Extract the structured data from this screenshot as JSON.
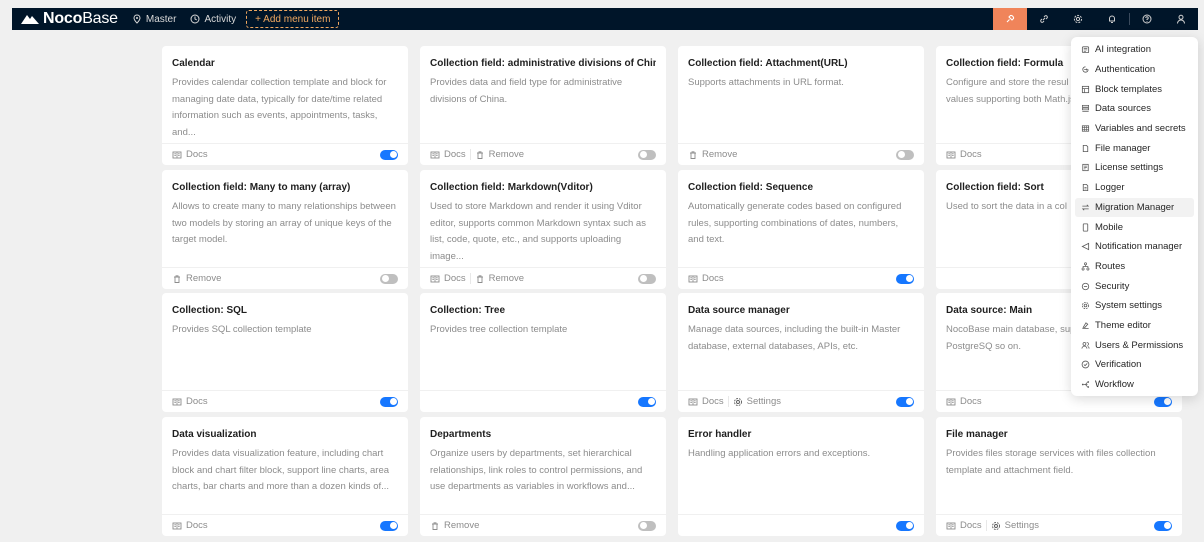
{
  "header": {
    "logo_bold": "Noco",
    "logo_light": "Base",
    "nav": [
      {
        "label": "Master",
        "icon": "location-pin-icon"
      },
      {
        "label": "Activity",
        "icon": "clock-icon"
      }
    ],
    "add_menu_label": "+ Add menu item",
    "right_icons": [
      "plugin-icon",
      "link-icon",
      "gear-icon",
      "bell-icon",
      "help-icon",
      "user-icon"
    ]
  },
  "footer_labels": {
    "docs": "Docs",
    "remove": "Remove",
    "settings": "Settings"
  },
  "cards": [
    {
      "title": "Calendar",
      "desc": "Provides calendar collection template and block for managing date data, typically for date/time related information such as events, appointments, tasks, and...",
      "docs": true,
      "remove": false,
      "settings": false,
      "enabled": true
    },
    {
      "title": "Collection field: administrative divisions of China",
      "desc": "Provides data and field type for administrative divisions of China.",
      "docs": true,
      "remove": true,
      "settings": false,
      "enabled": false
    },
    {
      "title": "Collection field: Attachment(URL)",
      "desc": "Supports attachments in URL format.",
      "docs": false,
      "remove": true,
      "settings": false,
      "enabled": false
    },
    {
      "title": "Collection field: Formula",
      "desc": "Configure and store the resul between multiple field values supporting both Math.js and",
      "docs": true,
      "remove": false,
      "settings": false,
      "enabled": null
    },
    {
      "title": "Collection field: Many to many (array)",
      "desc": "Allows to create many to many relationships between two models by storing an array of unique keys of the target model.",
      "docs": false,
      "remove": true,
      "settings": false,
      "enabled": false
    },
    {
      "title": "Collection field: Markdown(Vditor)",
      "desc": "Used to store Markdown and render it using Vditor editor, supports common Markdown syntax such as list, code, quote, etc., and supports uploading image...",
      "docs": true,
      "remove": true,
      "settings": false,
      "enabled": false
    },
    {
      "title": "Collection field: Sequence",
      "desc": "Automatically generate codes based on configured rules, supporting combinations of dates, numbers, and text.",
      "docs": true,
      "remove": false,
      "settings": false,
      "enabled": true
    },
    {
      "title": "Collection field: Sort",
      "desc": "Used to sort the data in a col",
      "docs": false,
      "remove": false,
      "settings": false,
      "enabled": null
    },
    {
      "title": "Collection: SQL",
      "desc": "Provides SQL collection template",
      "docs": true,
      "remove": false,
      "settings": false,
      "enabled": true
    },
    {
      "title": "Collection: Tree",
      "desc": "Provides tree collection template",
      "docs": false,
      "remove": false,
      "settings": false,
      "enabled": true
    },
    {
      "title": "Data source manager",
      "desc": "Manage data sources, including the built-in Master database, external databases, APIs, etc.",
      "docs": true,
      "remove": false,
      "settings": true,
      "enabled": true
    },
    {
      "title": "Data source: Main",
      "desc": "NocoBase main database, sup databases such as PostgreSQ so on.",
      "docs": true,
      "remove": false,
      "settings": false,
      "enabled": true
    },
    {
      "title": "Data visualization",
      "desc": "Provides data visualization feature, including chart block and chart filter block, support line charts, area charts, bar charts and more than a dozen kinds of...",
      "docs": true,
      "remove": false,
      "settings": false,
      "enabled": true
    },
    {
      "title": "Departments",
      "desc": "Organize users by departments, set hierarchical relationships, link roles to control permissions, and use departments as variables in workflows and...",
      "docs": false,
      "remove": true,
      "settings": false,
      "enabled": false
    },
    {
      "title": "Error handler",
      "desc": "Handling application errors and exceptions.",
      "docs": false,
      "remove": false,
      "settings": false,
      "enabled": true
    },
    {
      "title": "File manager",
      "desc": "Provides files storage services with files collection template and attachment field.",
      "docs": true,
      "remove": false,
      "settings": true,
      "enabled": true
    }
  ],
  "settings_menu": [
    {
      "label": "AI integration",
      "icon": "robot-icon"
    },
    {
      "label": "Authentication",
      "icon": "login-icon"
    },
    {
      "label": "Block templates",
      "icon": "layout-icon"
    },
    {
      "label": "Data sources",
      "icon": "database-icon"
    },
    {
      "label": "Variables and secrets",
      "icon": "table-icon"
    },
    {
      "label": "File manager",
      "icon": "file-icon"
    },
    {
      "label": "License settings",
      "icon": "license-icon"
    },
    {
      "label": "Logger",
      "icon": "log-icon"
    },
    {
      "label": "Migration Manager",
      "icon": "swap-icon",
      "hover": true
    },
    {
      "label": "Mobile",
      "icon": "mobile-icon"
    },
    {
      "label": "Notification manager",
      "icon": "send-icon"
    },
    {
      "label": "Routes",
      "icon": "routes-icon"
    },
    {
      "label": "Security",
      "icon": "shield-icon"
    },
    {
      "label": "System settings",
      "icon": "gear-icon"
    },
    {
      "label": "Theme editor",
      "icon": "theme-icon"
    },
    {
      "label": "Users & Permissions",
      "icon": "users-icon"
    },
    {
      "label": "Verification",
      "icon": "check-circle-icon"
    },
    {
      "label": "Workflow",
      "icon": "workflow-icon"
    }
  ]
}
